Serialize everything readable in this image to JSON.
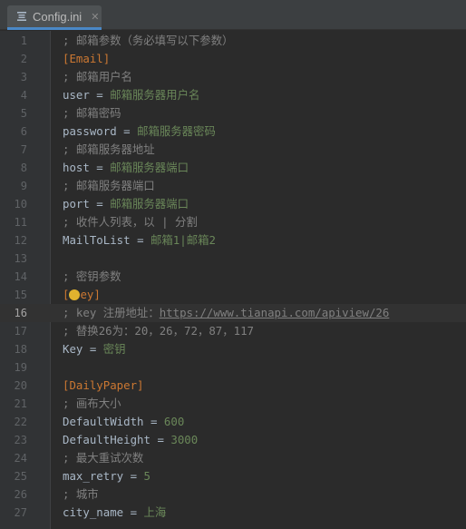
{
  "tab": {
    "label": "Config.ini",
    "icon": "ini-file-icon",
    "close": "✕",
    "accent": "#4a88c7"
  },
  "colors": {
    "comment": "#808080",
    "section": "#cc7832",
    "value": "#6a8759",
    "key": "#a9b7c6",
    "background": "#2b2b2b"
  },
  "current_line": 16,
  "lines": [
    {
      "n": "1",
      "segs": [
        {
          "t": "; 邮箱参数（务必填写以下参数）",
          "c": "comment"
        }
      ]
    },
    {
      "n": "2",
      "segs": [
        {
          "t": "[Email]",
          "c": "section"
        }
      ]
    },
    {
      "n": "3",
      "segs": [
        {
          "t": "; 邮箱用户名",
          "c": "comment"
        }
      ]
    },
    {
      "n": "4",
      "segs": [
        {
          "t": "user",
          "c": "key"
        },
        {
          "t": " = ",
          "c": "eq"
        },
        {
          "t": "邮箱服务器用户名",
          "c": "val"
        }
      ]
    },
    {
      "n": "5",
      "segs": [
        {
          "t": "; 邮箱密码",
          "c": "comment"
        }
      ]
    },
    {
      "n": "6",
      "segs": [
        {
          "t": "password",
          "c": "key"
        },
        {
          "t": " = ",
          "c": "eq"
        },
        {
          "t": "邮箱服务器密码",
          "c": "val"
        }
      ]
    },
    {
      "n": "7",
      "segs": [
        {
          "t": "; 邮箱服务器地址",
          "c": "comment"
        }
      ]
    },
    {
      "n": "8",
      "segs": [
        {
          "t": "host",
          "c": "key"
        },
        {
          "t": " = ",
          "c": "eq"
        },
        {
          "t": "邮箱服务器端口",
          "c": "val"
        }
      ]
    },
    {
      "n": "9",
      "segs": [
        {
          "t": "; 邮箱服务器端口",
          "c": "comment"
        }
      ]
    },
    {
      "n": "10",
      "segs": [
        {
          "t": "port",
          "c": "key"
        },
        {
          "t": " = ",
          "c": "eq"
        },
        {
          "t": "邮箱服务器端口",
          "c": "val"
        }
      ]
    },
    {
      "n": "11",
      "segs": [
        {
          "t": "; 收件人列表，以 | 分割",
          "c": "comment"
        }
      ]
    },
    {
      "n": "12",
      "segs": [
        {
          "t": "MailToList",
          "c": "key"
        },
        {
          "t": " = ",
          "c": "eq"
        },
        {
          "t": "邮箱1|邮箱2",
          "c": "val"
        }
      ]
    },
    {
      "n": "13",
      "segs": []
    },
    {
      "n": "14",
      "segs": [
        {
          "t": "; 密钥参数",
          "c": "comment"
        }
      ]
    },
    {
      "n": "15",
      "segs": [
        {
          "t": "[",
          "c": "section"
        },
        {
          "t": "",
          "c": "bulb"
        },
        {
          "t": "ey]",
          "c": "section"
        }
      ]
    },
    {
      "n": "16",
      "segs": [
        {
          "t": "; key 注册地址：",
          "c": "comment"
        },
        {
          "t": "https://www.tianapi.com/apiview/26",
          "c": "link"
        }
      ]
    },
    {
      "n": "17",
      "segs": [
        {
          "t": "; 替换26为：20，26，72，87，117",
          "c": "comment"
        }
      ]
    },
    {
      "n": "18",
      "segs": [
        {
          "t": "Key",
          "c": "key"
        },
        {
          "t": " = ",
          "c": "eq"
        },
        {
          "t": "密钥",
          "c": "val"
        }
      ]
    },
    {
      "n": "19",
      "segs": []
    },
    {
      "n": "20",
      "segs": [
        {
          "t": "[DailyPaper]",
          "c": "section"
        }
      ]
    },
    {
      "n": "21",
      "segs": [
        {
          "t": "; 画布大小",
          "c": "comment"
        }
      ]
    },
    {
      "n": "22",
      "segs": [
        {
          "t": "DefaultWidth",
          "c": "key"
        },
        {
          "t": " = ",
          "c": "eq"
        },
        {
          "t": "600",
          "c": "val"
        }
      ]
    },
    {
      "n": "23",
      "segs": [
        {
          "t": "DefaultHeight",
          "c": "key"
        },
        {
          "t": " = ",
          "c": "eq"
        },
        {
          "t": "3000",
          "c": "val"
        }
      ]
    },
    {
      "n": "24",
      "segs": [
        {
          "t": "; 最大重试次数",
          "c": "comment"
        }
      ]
    },
    {
      "n": "25",
      "segs": [
        {
          "t": "max_retry",
          "c": "key"
        },
        {
          "t": " = ",
          "c": "eq"
        },
        {
          "t": "5",
          "c": "val"
        }
      ]
    },
    {
      "n": "26",
      "segs": [
        {
          "t": "; 城市",
          "c": "comment"
        }
      ]
    },
    {
      "n": "27",
      "segs": [
        {
          "t": "city_name",
          "c": "key"
        },
        {
          "t": " = ",
          "c": "eq"
        },
        {
          "t": "上海",
          "c": "val"
        }
      ]
    }
  ]
}
